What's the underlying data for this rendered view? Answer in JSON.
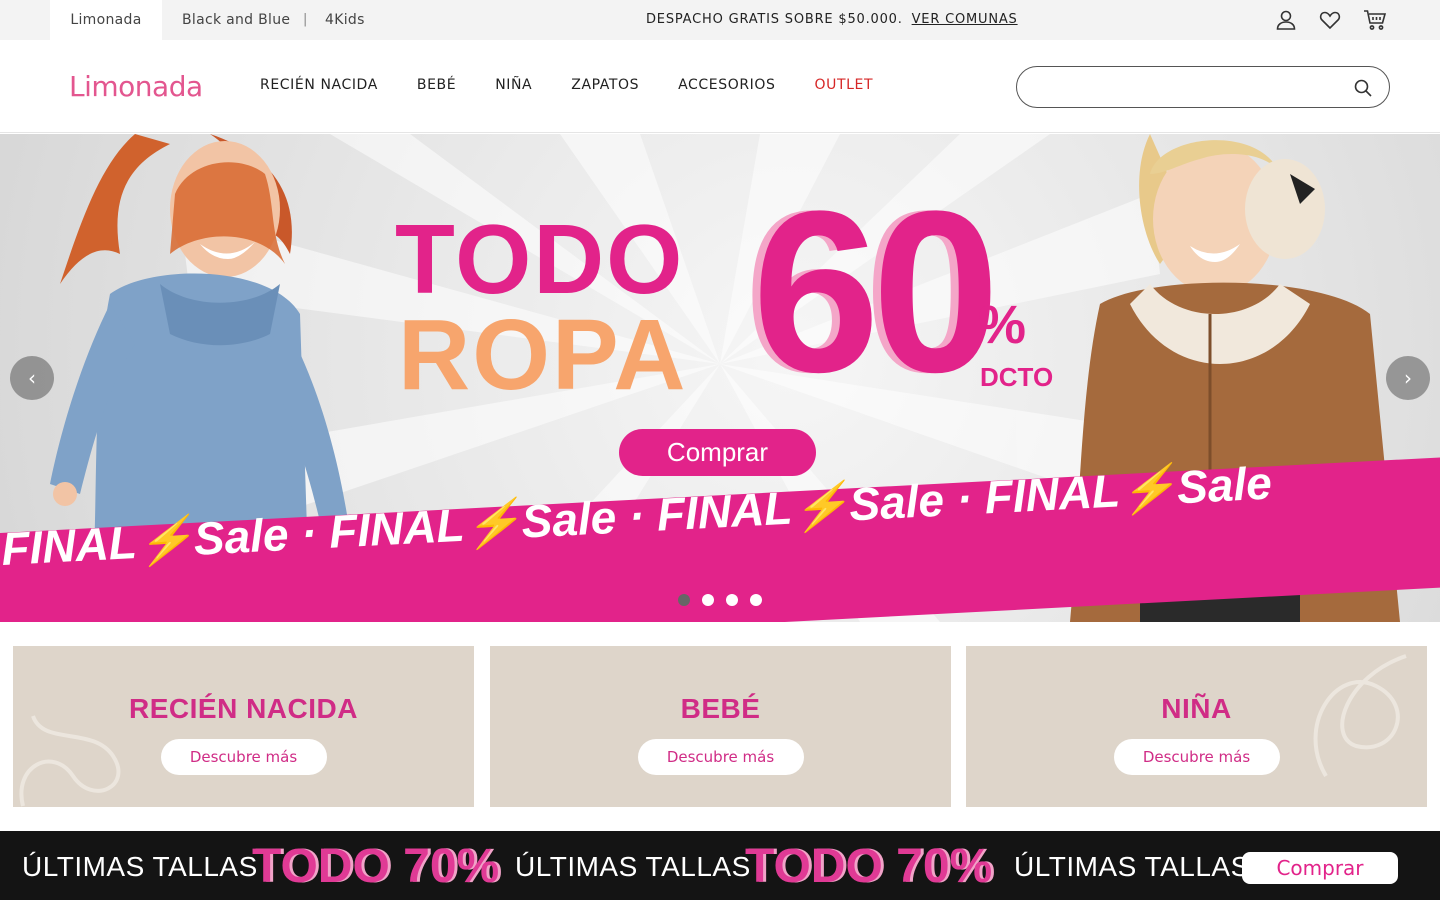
{
  "topbar": {
    "brands": [
      "Limonada",
      "Black and Blue",
      "4Kids"
    ],
    "separator": "|",
    "promo_text": "DESPACHO GRATIS SOBRE $50.000.",
    "promo_link": "VER COMUNAS",
    "icons": [
      "user-icon",
      "heart-icon",
      "cart-icon"
    ]
  },
  "header": {
    "logo": "Limonada",
    "nav": [
      "RECIÉN NACIDA",
      "BEBÉ",
      "NIÑA",
      "ZAPATOS",
      "ACCESORIOS",
      "OUTLET"
    ],
    "search_placeholder": "",
    "accent_color": "#e3568f",
    "outlet_color": "#d62626"
  },
  "hero": {
    "line1": "TODO",
    "line2": "ROPA",
    "discount": "60",
    "percent": "%",
    "dcto": "DCTO",
    "button": "Comprar",
    "sale_text": "FINAL⚡Sale · FINAL⚡Sale · FINAL⚡Sale · FINAL⚡Sale",
    "prev": "‹",
    "next": "›",
    "slides": 4,
    "active_slide": 1,
    "colors": {
      "pink": "#e2238a",
      "orange": "#f7a56d"
    }
  },
  "categories": [
    {
      "title": "RECIÉN NACIDA",
      "button": "Descubre más"
    },
    {
      "title": "BEBÉ",
      "button": "Descubre más"
    },
    {
      "title": "NIÑA",
      "button": "Descubre más"
    }
  ],
  "bottom_banner": {
    "text1": "ÚLTIMAS TALLAS",
    "big1": "TODO 70%",
    "text2": "ÚLTIMAS TALLAS",
    "big2": "TODO 70%",
    "text3": "ÚLTIMAS TALLAS",
    "button": "Comprar"
  }
}
